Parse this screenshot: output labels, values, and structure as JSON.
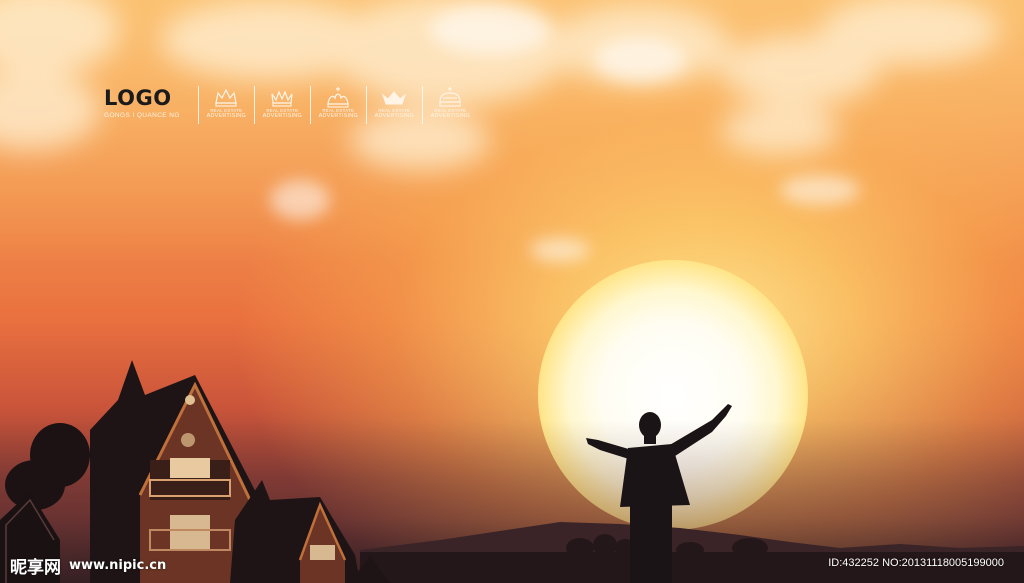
{
  "logo": {
    "title": "LOGO",
    "subtitle": "GONGS I QUANCE NG"
  },
  "badges": [
    {
      "icon": "crown-icon",
      "small": "REAL ESTATE",
      "big": "ADVERTISING"
    },
    {
      "icon": "crown-icon",
      "small": "REAL ESTATE",
      "big": "ADVERTISING"
    },
    {
      "icon": "crown-icon",
      "small": "REAL ESTATE",
      "big": "ADVERTISING"
    },
    {
      "icon": "crown-icon",
      "small": "REAL ESTATE",
      "big": "ADVERTISING"
    },
    {
      "icon": "crown-icon",
      "small": "REAL ESTATE",
      "big": "ADVERTISING"
    }
  ],
  "watermark": {
    "brand": "昵享网",
    "url": "www.nipic.cn",
    "id": "ID:432252 NO:20131118005199000"
  },
  "colors": {
    "sky_top": "#f7b36a",
    "sun": "#ffffff",
    "silhouette": "#1e1416"
  }
}
